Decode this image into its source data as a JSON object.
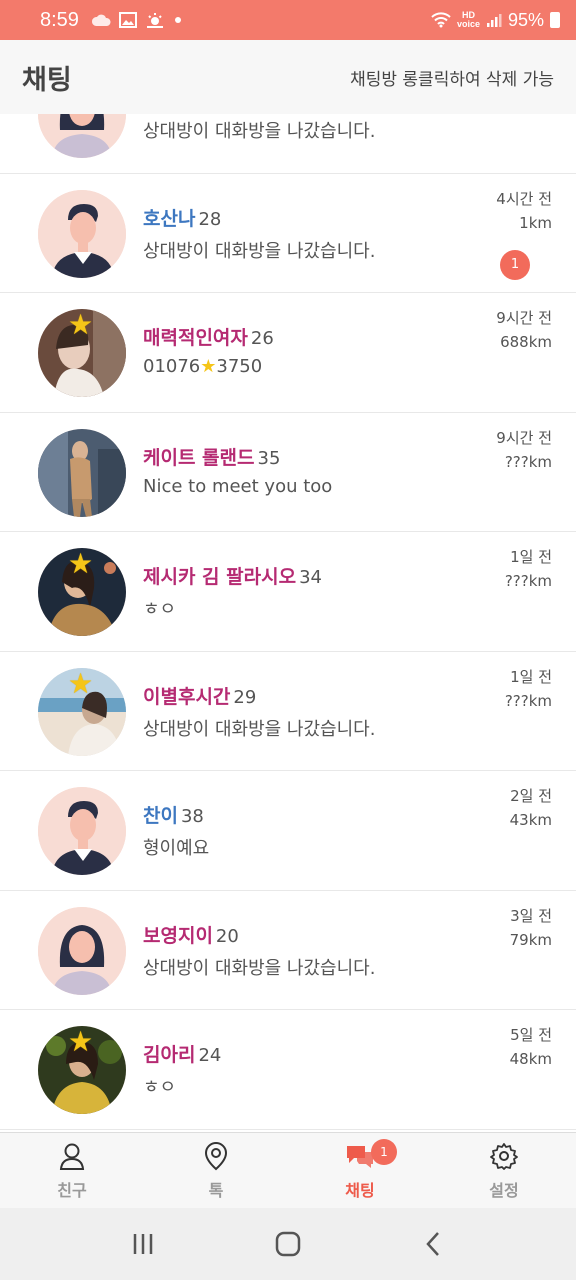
{
  "status_bar": {
    "time": "8:59",
    "battery": "95%"
  },
  "header": {
    "title": "채팅",
    "hint": "채팅방 롱클릭하여 삭제 가능"
  },
  "chats": [
    {
      "name": "",
      "age": "",
      "message": "상대방이 대화방을 나갔습니다.",
      "time": "",
      "distance": "",
      "gender": "female",
      "avatar": "female-default",
      "unread": ""
    },
    {
      "name": "호산나",
      "age": "28",
      "message": "상대방이 대화방을 나갔습니다.",
      "time": "4시간 전",
      "distance": "1km",
      "gender": "male",
      "avatar": "male-default",
      "unread": "1"
    },
    {
      "name": "매력적인여자",
      "age": "26",
      "message_before": "01076",
      "message_after": "3750",
      "time": "9시간 전",
      "distance": "688km",
      "gender": "female",
      "avatar": "photo",
      "unread": ""
    },
    {
      "name": "케이트 롤랜드",
      "age": "35",
      "message": "Nice to meet you too",
      "time": "9시간 전",
      "distance": "???km",
      "gender": "female",
      "avatar": "photo",
      "unread": ""
    },
    {
      "name": "제시카 김 팔라시오",
      "age": "34",
      "message": "ㅎㅇ",
      "time": "1일 전",
      "distance": "???km",
      "gender": "female",
      "avatar": "photo",
      "unread": ""
    },
    {
      "name": "이별후시간",
      "age": "29",
      "message": "상대방이 대화방을 나갔습니다.",
      "time": "1일 전",
      "distance": "???km",
      "gender": "female",
      "avatar": "photo",
      "unread": ""
    },
    {
      "name": "찬이",
      "age": "38",
      "message": "형이예요",
      "time": "2일 전",
      "distance": "43km",
      "gender": "male",
      "avatar": "male-default",
      "unread": ""
    },
    {
      "name": "보영지이",
      "age": "20",
      "message": "상대방이 대화방을 나갔습니다.",
      "time": "3일 전",
      "distance": "79km",
      "gender": "female",
      "avatar": "female-default",
      "unread": ""
    },
    {
      "name": "김아리",
      "age": "24",
      "message": "ㅎㅇ",
      "time": "5일 전",
      "distance": "48km",
      "gender": "female",
      "avatar": "photo",
      "unread": ""
    }
  ],
  "bottom_nav": [
    {
      "label": "친구",
      "icon": "person-icon",
      "active": false
    },
    {
      "label": "톡",
      "icon": "location-pin-icon",
      "active": false
    },
    {
      "label": "채팅",
      "icon": "chat-bubbles-icon",
      "active": true,
      "badge": "1"
    },
    {
      "label": "설정",
      "icon": "gear-icon",
      "active": false
    }
  ],
  "colors": {
    "accent": "#f37a6b",
    "male_name": "#3d77c0",
    "female_name": "#b52a72",
    "badge": "#f26b5b"
  }
}
